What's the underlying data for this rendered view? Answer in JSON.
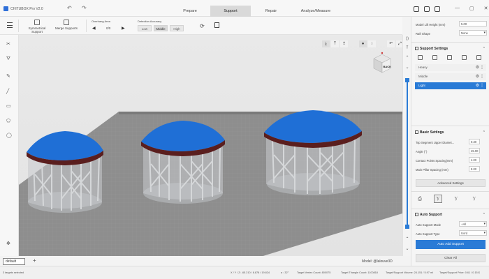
{
  "app": {
    "title": "CHITUBOX Pro V2.0"
  },
  "tabs": [
    "Prepare",
    "Support",
    "Repair",
    "Analyze/Measure"
  ],
  "active_tab": "Support",
  "toolbar": {
    "symmetrical_support": "Symmetrical Support",
    "merge_supports": "Merge Supports",
    "overhang_label": "Overhang Area",
    "overhang_value": "0/0",
    "detection_label": "Detection Accuracy",
    "detection_options": [
      "Low",
      "Middle",
      "High"
    ],
    "detection_selected": "Middle"
  },
  "right_panel": {
    "model_lift_label": "Model Lift Height (mm)",
    "model_lift_value": "5.00",
    "raft_shape_label": "Raft Shape",
    "raft_shape_value": "None",
    "support_settings_title": "Support Settings",
    "presets": [
      "Heavy",
      "Middle",
      "Light"
    ],
    "preset_selected": "Light",
    "basic_settings_title": "Basic Settings",
    "basic_fields": [
      {
        "label": "Top Segment Upper Diamet...",
        "value": "0.30"
      },
      {
        "label": "Angle (°)",
        "value": "45.00"
      },
      {
        "label": "Contact Points Spacing(mm)",
        "value": "4.00"
      },
      {
        "label": "Main Pillar Spacing (mm)",
        "value": "8.00"
      }
    ],
    "advanced_settings": "Advanced Settings",
    "auto_support_title": "Auto Support",
    "auto_support_mode_label": "Auto Support Mode",
    "auto_support_mode_value": "+All",
    "auto_support_type_label": "Auto Support Type",
    "auto_support_type_value": "Uord",
    "auto_add_support": "Auto Add Support",
    "clear_all": "Clear All"
  },
  "model": {
    "label": "Model: @lalouve3D"
  },
  "doc_tab": "default",
  "status": {
    "targets_selected": "3 targets selected",
    "xyz": "X / Y / Z:  -65.210 / 8.878 / 19.824",
    "alpha": "α :  32°",
    "vertex": "Target Vertex Count:  800075",
    "triangle": "Target Triangle Count:  1100818",
    "volume": "Target/Support Volume:  24.151 / 5.97 ml",
    "price": "Target/Support Price:  0.61 / 0.15 $"
  },
  "colors": {
    "accent": "#2a7bd6",
    "model_blue": "#1f6fd6",
    "support_grey": "#c7c9cc",
    "plate": "#8f8f8f"
  }
}
